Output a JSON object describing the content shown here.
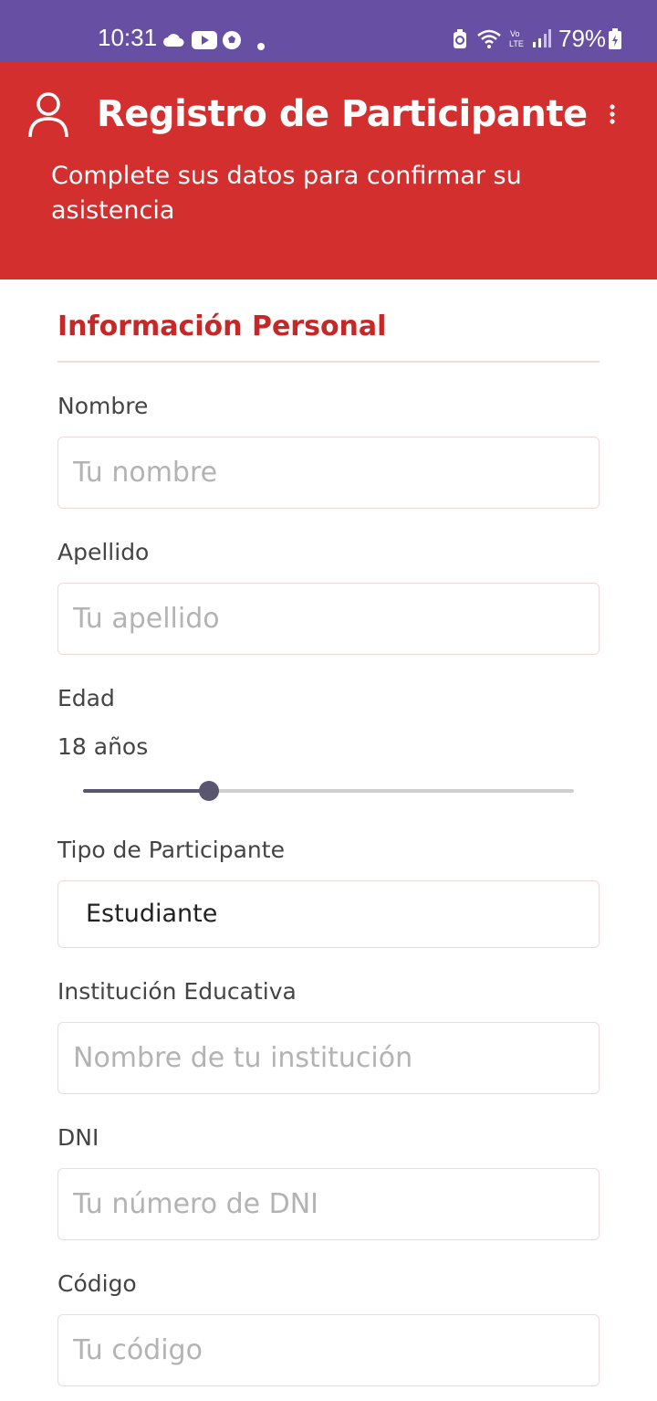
{
  "status_bar": {
    "time": "10:31",
    "battery": "79%",
    "icons": [
      "cloud-icon",
      "youtube-icon",
      "soccer-ball-icon",
      "dot-icon",
      "battery-saver-icon",
      "wifi-icon",
      "volte-icon",
      "signal-icon",
      "battery-icon"
    ]
  },
  "header": {
    "title": "Registro de Participante",
    "subtitle": "Complete sus datos para confirmar su asistencia",
    "background": "#d32f2f"
  },
  "section": {
    "title": "Información Personal",
    "color": "#c62828"
  },
  "form": {
    "nombre": {
      "label": "Nombre",
      "placeholder": "Tu nombre"
    },
    "apellido": {
      "label": "Apellido",
      "placeholder": "Tu apellido"
    },
    "edad": {
      "label": "Edad",
      "value_text": "18 años",
      "value": 18,
      "slider_fraction": 0.257
    },
    "tipo": {
      "label": "Tipo de Participante",
      "value": "Estudiante"
    },
    "institucion": {
      "label": "Institución Educativa",
      "placeholder": "Nombre de tu institución"
    },
    "dni": {
      "label": "DNI",
      "placeholder": "Tu número de DNI"
    },
    "codigo": {
      "label": "Código",
      "placeholder": "Tu código"
    }
  },
  "colors": {
    "status_bar": "#6750a4",
    "accent": "#d32f2f",
    "slider": "#5b5670"
  }
}
